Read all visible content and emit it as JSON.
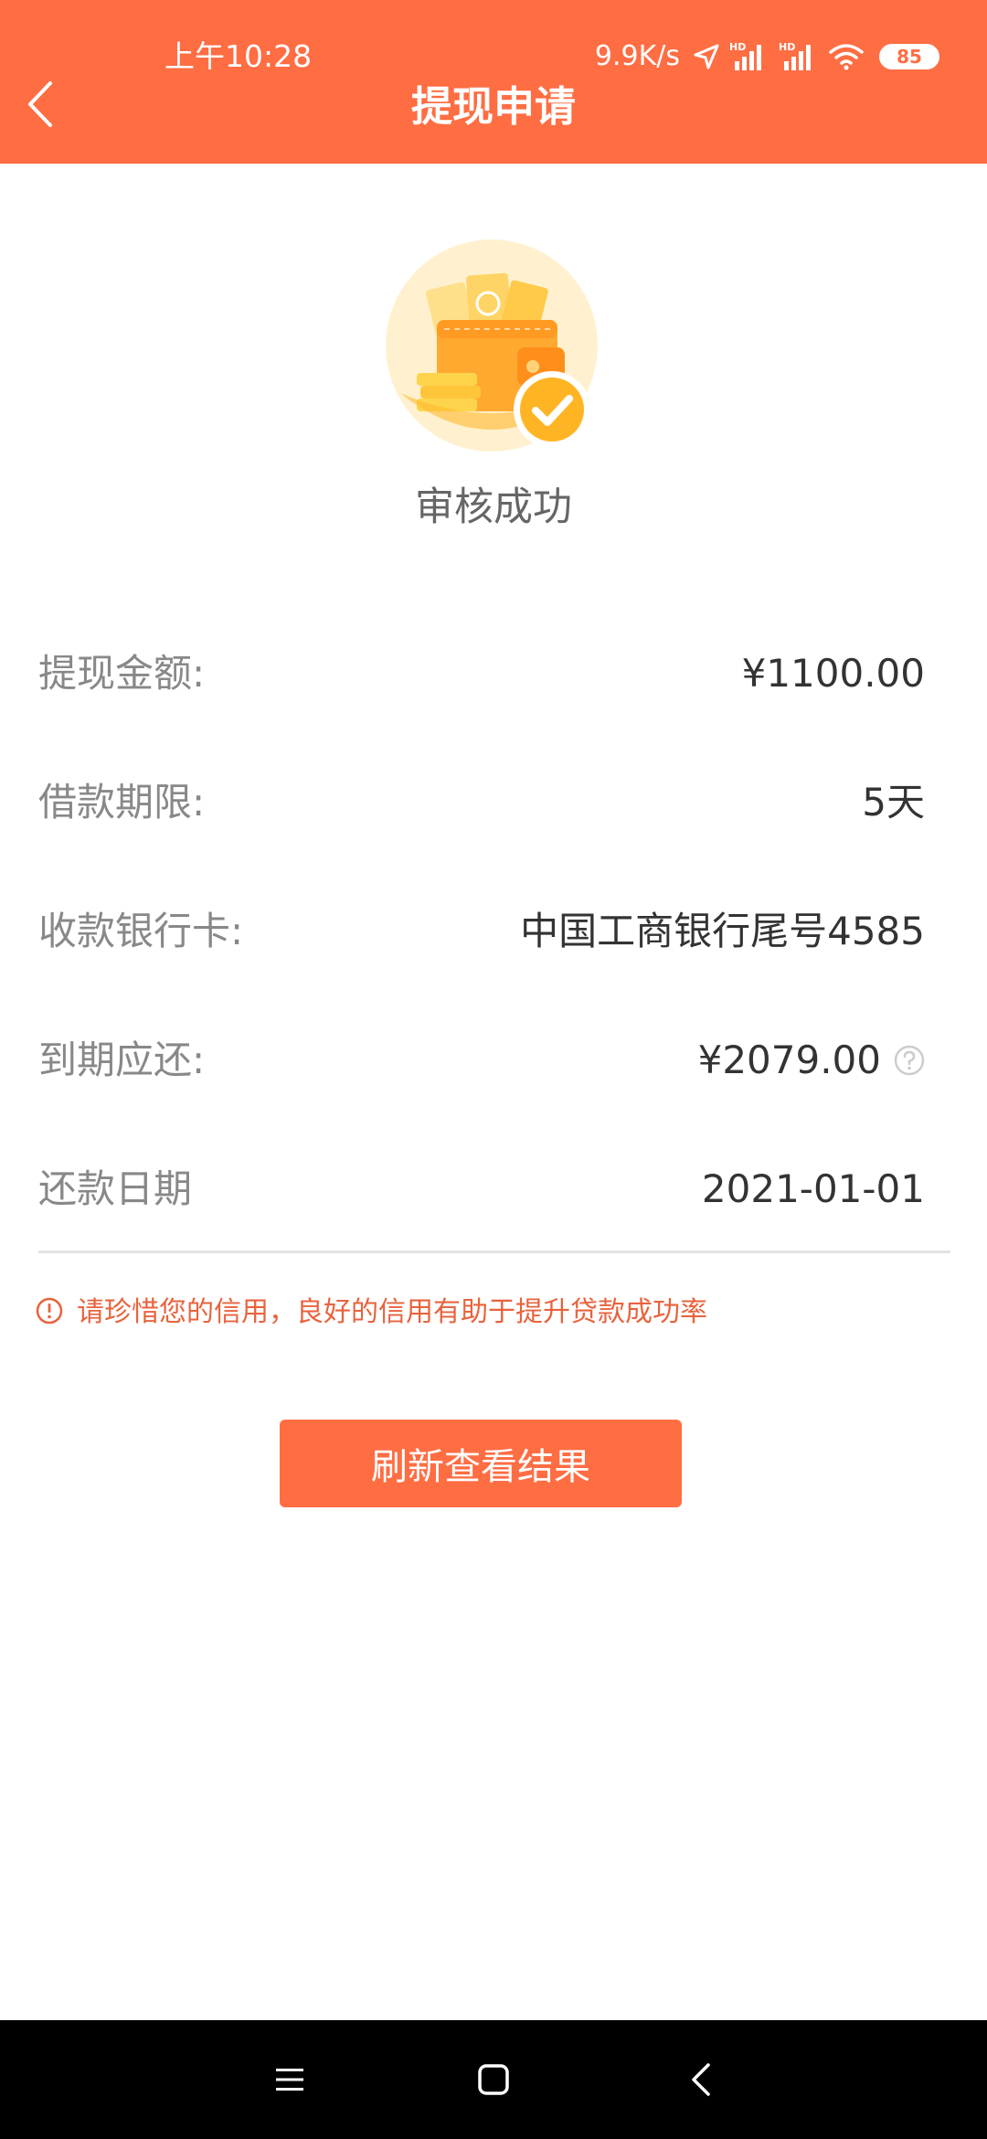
{
  "status_bar": {
    "time": "上午10:28",
    "net_speed": "9.9K/s",
    "battery": "85",
    "icons": [
      "location-arrow-icon",
      "hd-signal-icon",
      "hd-signal-icon",
      "wifi-icon",
      "battery-icon"
    ]
  },
  "header": {
    "title": "提现申请",
    "back_icon": "chevron-left-icon"
  },
  "hero": {
    "icon": "wallet-check-illustration",
    "status": "审核成功"
  },
  "info": {
    "rows": [
      {
        "label": "提现金额:",
        "value": "¥1100.00"
      },
      {
        "label": "借款期限:",
        "value": "5天"
      },
      {
        "label": "收款银行卡:",
        "value": "中国工商银行尾号4585"
      },
      {
        "label": "到期应还:",
        "value": "¥2079.00"
      },
      {
        "label": "还款日期",
        "value": "2021-01-01"
      }
    ]
  },
  "notice": {
    "text": "请珍惜您的信用，良好的信用有助于提升贷款成功率"
  },
  "actions": {
    "refresh_label": "刷新查看结果"
  },
  "colors": {
    "primary": "#FF6D43",
    "notice": "#E8633D",
    "label": "#888888",
    "value": "#333333"
  }
}
